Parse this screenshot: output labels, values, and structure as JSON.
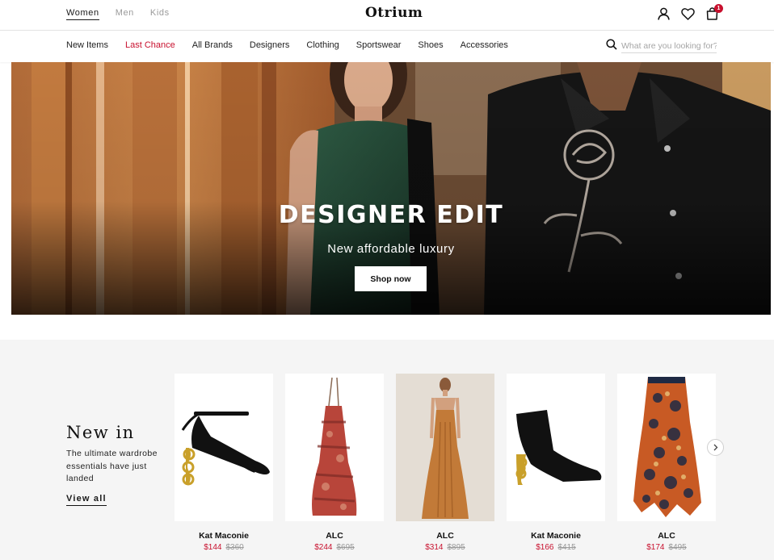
{
  "header": {
    "gender_tabs": [
      {
        "label": "Women",
        "active": true
      },
      {
        "label": "Men",
        "active": false
      },
      {
        "label": "Kids",
        "active": false
      }
    ],
    "logo": "Otrium",
    "icons": [
      "account-icon",
      "wishlist-heart-icon",
      "cart-bag-icon"
    ],
    "cart_count": "1"
  },
  "nav": {
    "items": [
      "New Items",
      "Last Chance",
      "All Brands",
      "Designers",
      "Clothing",
      "Sportswear",
      "Shoes",
      "Accessories"
    ],
    "sale_item": "Last Chance",
    "search_placeholder": "What are you looking for?"
  },
  "hero": {
    "title": "DESIGNER EDIT",
    "subtitle": "New affordable luxury",
    "cta": "Shop now"
  },
  "new_in": {
    "title": "New in",
    "description": "The ultimate wardrobe essentials have just landed",
    "link": "View all",
    "products": [
      {
        "brand": "Kat Maconie",
        "price": "$144",
        "old_price": "$360",
        "image": "black-strappy-heel"
      },
      {
        "brand": "ALC",
        "price": "$244",
        "old_price": "$695",
        "image": "red-print-halter-dress"
      },
      {
        "brand": "ALC",
        "price": "$314",
        "old_price": "$895",
        "image": "orange-pleated-maxi-dress"
      },
      {
        "brand": "Kat Maconie",
        "price": "$166",
        "old_price": "$415",
        "image": "black-ankle-boot"
      },
      {
        "brand": "ALC",
        "price": "$174",
        "old_price": "$495",
        "image": "floral-print-maxi-skirt"
      }
    ]
  },
  "colors": {
    "accent_sale": "#c8102e",
    "section_bg": "#f5f5f5"
  }
}
